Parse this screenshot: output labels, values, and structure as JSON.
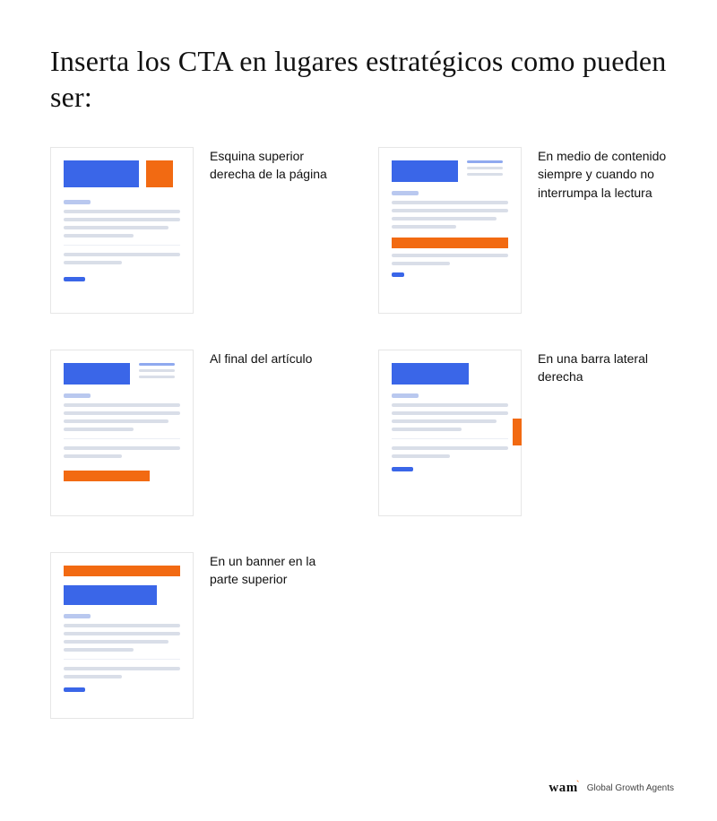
{
  "title": "Inserta los CTA en lugares estratégicos como pueden ser:",
  "items": [
    {
      "caption": "Esquina superior derecha de la página"
    },
    {
      "caption": "En medio de contenido siempre y cuando no interrumpa la lectura"
    },
    {
      "caption": "Al final del artículo"
    },
    {
      "caption": "En una barra lateral derecha"
    },
    {
      "caption": "En un banner en la parte superior"
    }
  ],
  "brand": {
    "name": "wam",
    "tagline": "Global Growth Agents"
  },
  "colors": {
    "primary_blue": "#3a66e8",
    "accent_orange": "#f26a12"
  }
}
